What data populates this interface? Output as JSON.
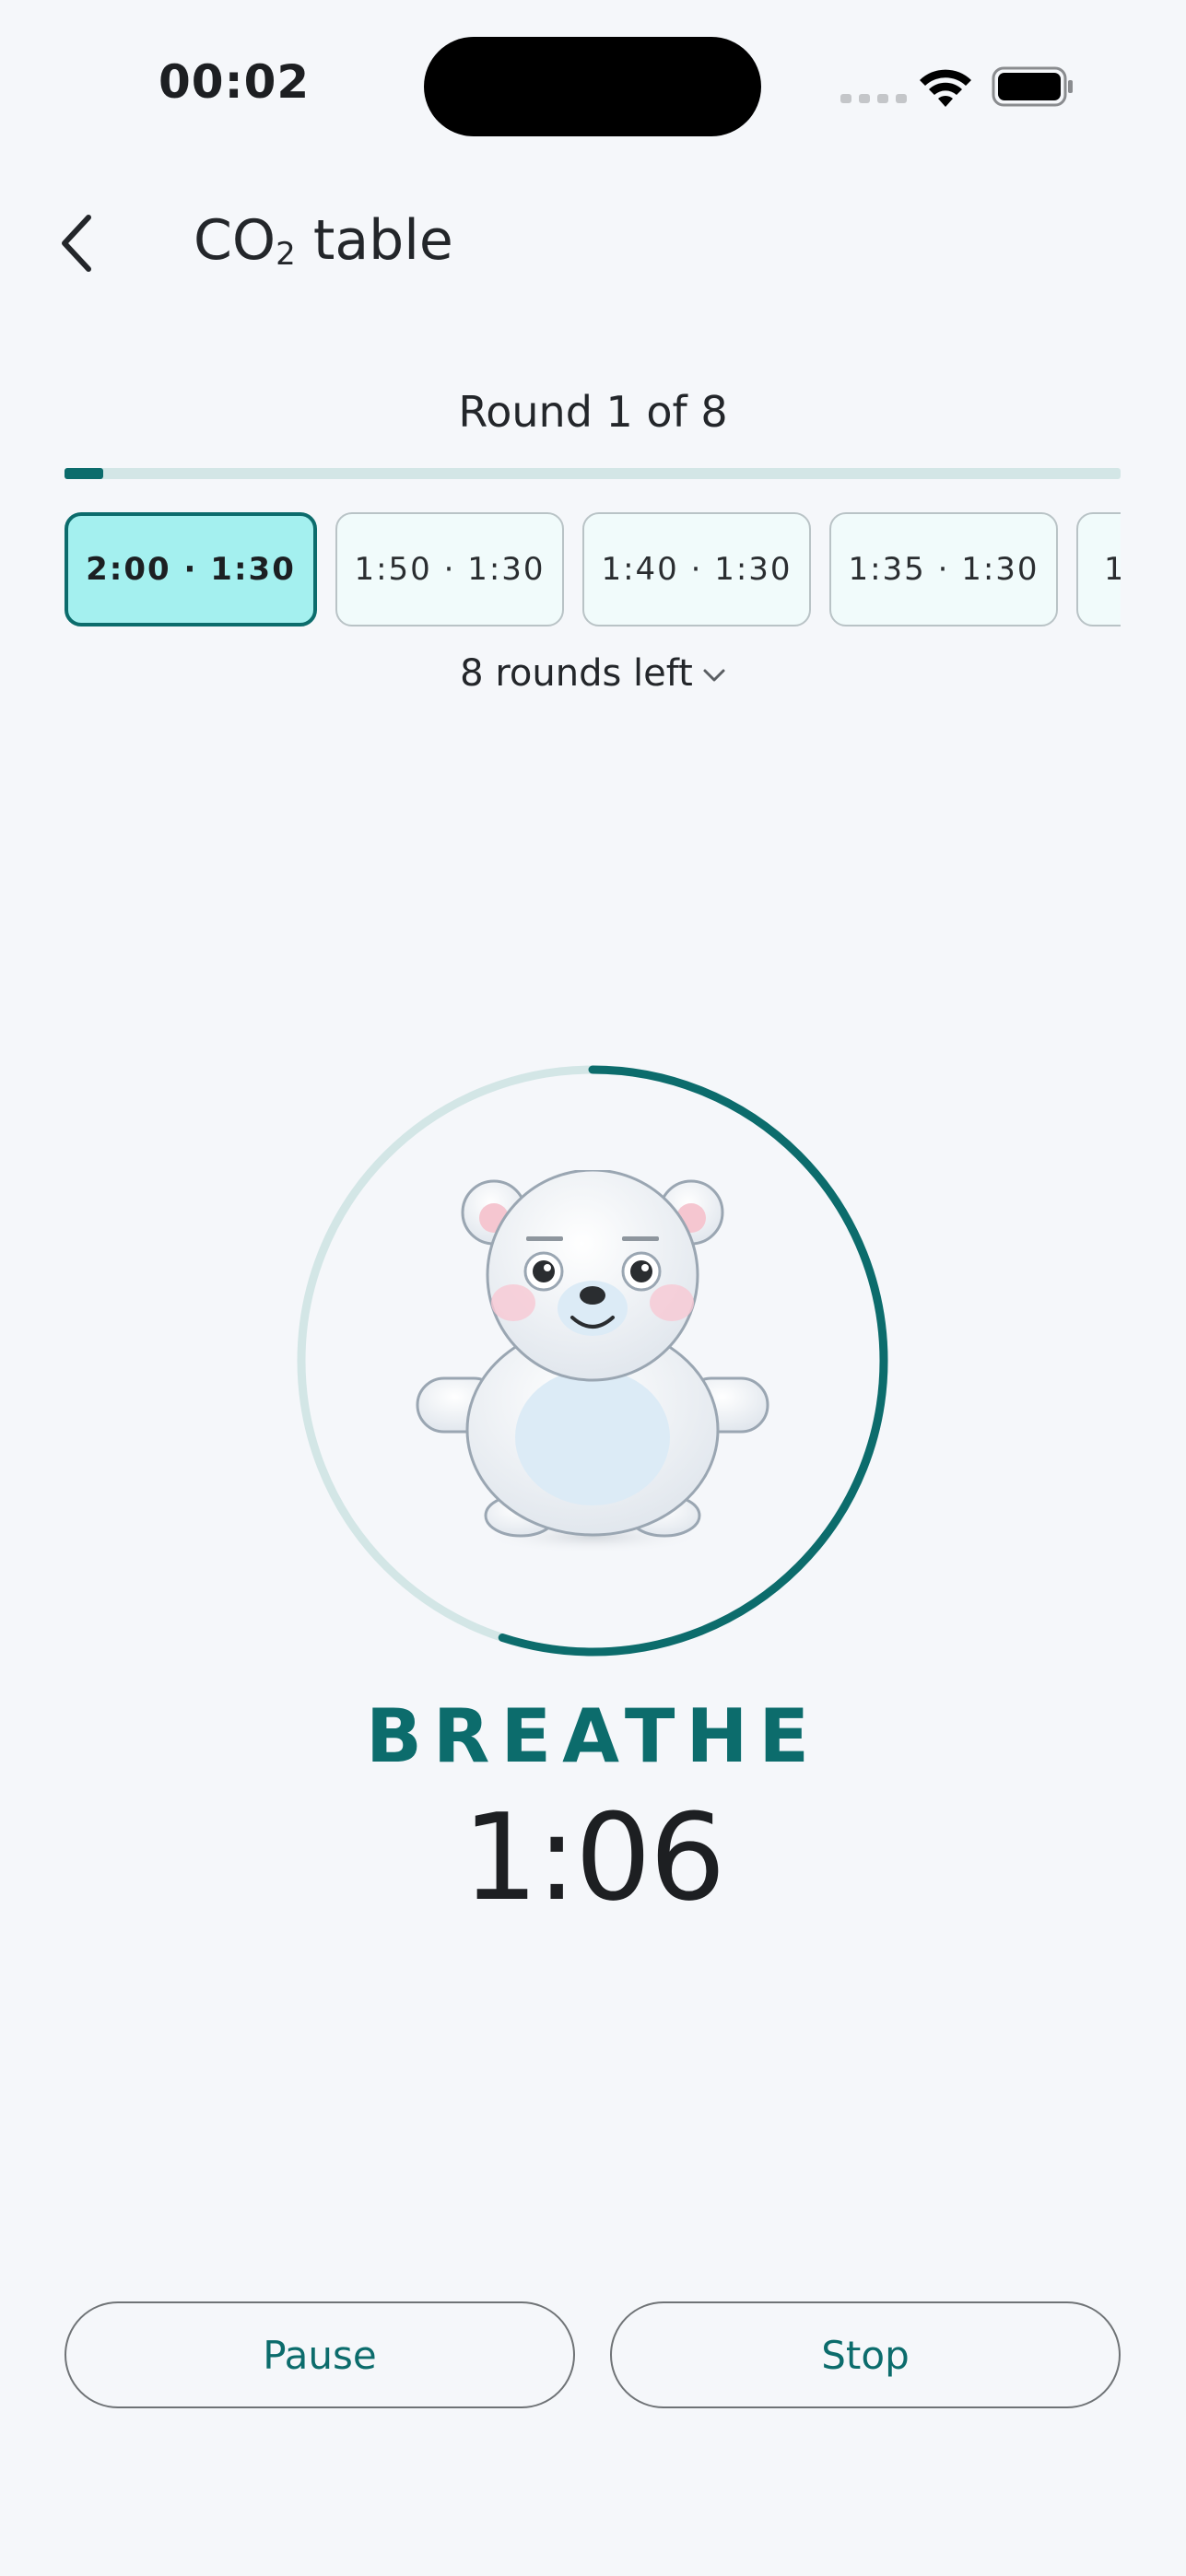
{
  "status_bar": {
    "time": "00:02"
  },
  "header": {
    "title_main": "CO",
    "title_sub": "2",
    "title_rest": " table"
  },
  "round": {
    "label": "Round 1 of 8",
    "progress_fraction": 0.037,
    "progress_color": "#0c6c6c",
    "chips": [
      {
        "label": "2:00 · 1:30",
        "active": true
      },
      {
        "label": "1:50 · 1:30",
        "active": false
      },
      {
        "label": "1:40 · 1:30",
        "active": false
      },
      {
        "label": "1:35 · 1:30",
        "active": false
      },
      {
        "label": "1",
        "active": false
      }
    ],
    "rounds_left": "8 rounds left"
  },
  "timer": {
    "ring_progress_fraction": 0.55,
    "phase": "BREATHE",
    "time": "1:06",
    "accent_color": "#0c6c6c",
    "icon": "polar-bear-mascot"
  },
  "controls": {
    "pause_label": "Pause",
    "stop_label": "Stop"
  }
}
